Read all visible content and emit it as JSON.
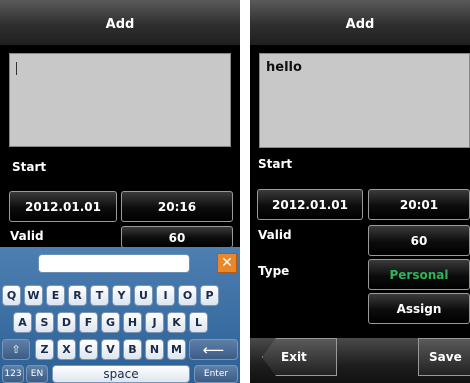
{
  "left": {
    "title": "Add",
    "text_value": "",
    "start_label": "Start",
    "start_date": "2012.01.01",
    "start_time": "20:16",
    "valid_label": "Valid",
    "valid_value": "60",
    "keyboard": {
      "close_glyph": "✕",
      "row1": [
        "Q",
        "W",
        "E",
        "R",
        "T",
        "Y",
        "U",
        "I",
        "O",
        "P"
      ],
      "row2": [
        "A",
        "S",
        "D",
        "F",
        "G",
        "H",
        "J",
        "K",
        "L"
      ],
      "row3": [
        "Z",
        "X",
        "C",
        "V",
        "B",
        "N",
        "M"
      ],
      "shift_glyph": "⇧",
      "backspace_glyph": "⟵",
      "numeric_key": "123",
      "lang_key": "EN",
      "space_key": "space",
      "enter_key": "Enter"
    }
  },
  "right": {
    "title": "Add",
    "text_value": "hello",
    "start_label": "Start",
    "start_date": "2012.01.01",
    "start_time": "20:01",
    "valid_label": "Valid",
    "valid_value": "60",
    "type_label": "Type",
    "type_value": "Personal",
    "assign_label": "Assign",
    "exit_label": "Exit",
    "save_label": "Save"
  },
  "colors": {
    "accent_green": "#2fb35a",
    "keyboard_blue": "#3b6fa4",
    "close_orange": "#e8882a"
  }
}
